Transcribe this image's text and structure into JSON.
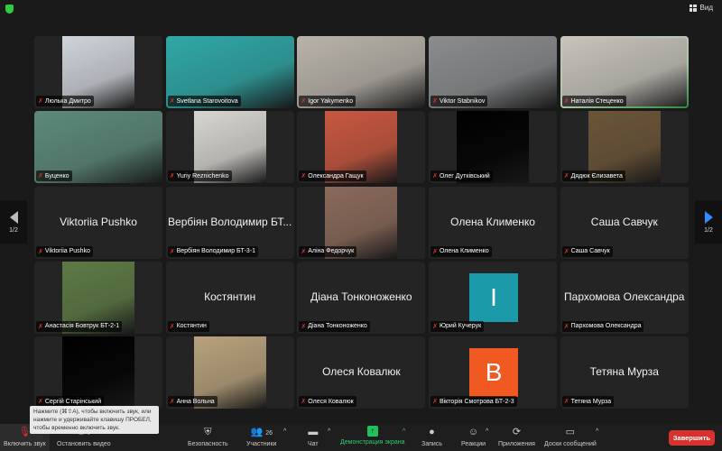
{
  "view_label": "Вид",
  "pager": {
    "left": "1/2",
    "right": "1/2"
  },
  "tiles": [
    {
      "name": "Люлька Дмитро",
      "type": "video",
      "img": "center",
      "bg": "#cfd4db"
    },
    {
      "name": "Svetlana Starovoitova",
      "type": "video",
      "img": "full",
      "bg": "#2fa8a6"
    },
    {
      "name": "Igor Yakymenko",
      "type": "video",
      "img": "full",
      "bg": "#b9b3aa"
    },
    {
      "name": "Viktor Stabnikov",
      "type": "video",
      "img": "full",
      "bg": "#8a8c8e"
    },
    {
      "name": "Наталія Стеценко",
      "type": "video",
      "img": "full",
      "bg": "#c8c4bc",
      "active": true
    },
    {
      "name": "Буценко",
      "type": "video",
      "img": "full",
      "bg": "#5c8a7a"
    },
    {
      "name": "Yuriy Reznichenko",
      "type": "video",
      "img": "center",
      "bg": "#d8d6d0"
    },
    {
      "name": "Олександра Гащук",
      "type": "video",
      "img": "center",
      "bg": "#c8573f"
    },
    {
      "name": "Олег Дутківський",
      "type": "video",
      "img": "center",
      "bg": "#000000"
    },
    {
      "name": "Дядюк Єлизавета",
      "type": "video",
      "img": "center",
      "bg": "#6b5538"
    },
    {
      "name": "Viktoriia Pushko",
      "type": "name"
    },
    {
      "name": "Вербіян Володимир БТ-3-1",
      "display": "Вербіян Володимир БТ...",
      "type": "name"
    },
    {
      "name": "Аліна Федорчук",
      "type": "video",
      "img": "center",
      "bg": "#8a6a5a"
    },
    {
      "name": "Олена Клименко",
      "type": "name"
    },
    {
      "name": "Саша Савчук",
      "type": "name"
    },
    {
      "name": "Анастасія Бовтрук БТ-2-1",
      "type": "video",
      "img": "center",
      "bg": "#5d7a45"
    },
    {
      "name": "Костянтин",
      "type": "name"
    },
    {
      "name": "Діана Тонконоженко",
      "type": "name"
    },
    {
      "name": "Юрий Кучерук",
      "type": "avatar",
      "letter": "I",
      "color": "#1b9aaa"
    },
    {
      "name": "Пархомова Олександра",
      "type": "name"
    },
    {
      "name": "Сергій Старінський",
      "type": "video",
      "img": "center",
      "bg": "#000000"
    },
    {
      "name": "Анна Вольна",
      "type": "video",
      "img": "center",
      "bg": "#b8a27c"
    },
    {
      "name": "Олеся Ковалюк",
      "type": "name"
    },
    {
      "name": "Вікторія Смотрова БТ-2-3",
      "type": "avatar",
      "letter": "B",
      "color": "#f05a22"
    },
    {
      "name": "Тетяна Мурза",
      "type": "name"
    }
  ],
  "tooltip": "Нажмите  (⌘⇧A), чтобы включить звук, или нажмите и удерживайте клавишу ПРОБЕЛ, чтобы временно включить звук.",
  "toolbar": {
    "unmute": "Включить звук",
    "stop_video": "Остановить видео",
    "security": "Безопасность",
    "participants": "Участники",
    "participants_count": "26",
    "chat": "Чат",
    "share": "Демонстрация экрана",
    "record": "Запись",
    "reactions": "Реакции",
    "apps": "Приложения",
    "whiteboards": "Доски сообщений",
    "end": "Завершить"
  },
  "colors": {
    "active_speaker": "#3fd15b",
    "share": "#20c05c",
    "end": "#d9312e",
    "muted": "#e0302c"
  }
}
